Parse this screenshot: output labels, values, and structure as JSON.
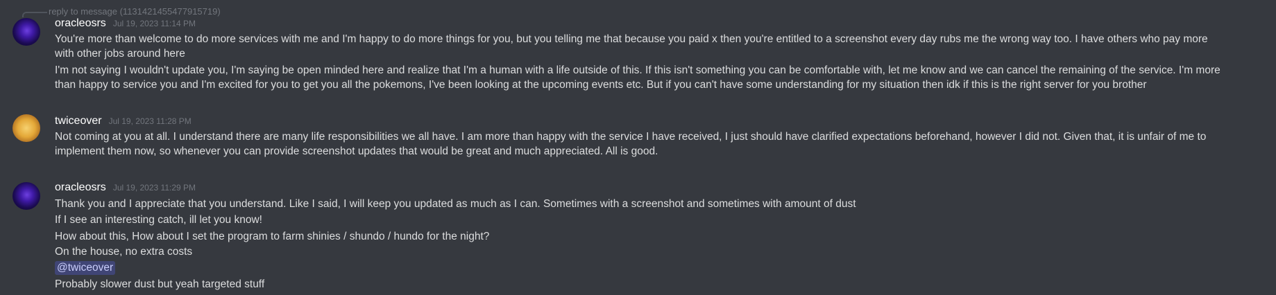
{
  "reply": {
    "text": "reply to message (1131421455477915719)"
  },
  "messages": [
    {
      "username": "oracleosrs",
      "timestamp": "Jul 19, 2023 11:14 PM",
      "lines": [
        "You're more than welcome to do more services with me and I'm happy to do more things for you, but you telling me that because you paid x then you're entitled to a screenshot every day rubs me the wrong way too. I have others who pay more",
        "with other jobs around here",
        "I'm not saying I wouldn't update you, I'm saying be open minded here and realize that I'm a human with a life outside of this. If this isn't something you can be comfortable with, let me know and we can cancel the remaining of the service. I'm more",
        "than happy to service you and I'm excited for you to get you all the pokemons, I've been looking at the upcoming events etc. But if you can't have some understanding for my situation then idk if this is the right server for you brother"
      ]
    },
    {
      "username": "twiceover",
      "timestamp": "Jul 19, 2023 11:28 PM",
      "lines": [
        "Not coming at you at all. I understand there are many life responsibilities we all have. I am more than happy with the service I have received, I just should have clarified expectations beforehand, however I did not. Given that, it is unfair of me to",
        "implement them now, so whenever you can provide screenshot updates that would be great and much appreciated. All is good."
      ]
    },
    {
      "username": "oracleosrs",
      "timestamp": "Jul 19, 2023 11:29 PM",
      "lines": [
        "Thank you and I appreciate that you understand. Like I said, I will keep you updated as much as I can. Sometimes with a screenshot and sometimes with amount of dust",
        "If I see an interesting catch, ill let you know!",
        "How about this, How about I set the program to farm shinies / shundo / hundo for the night?",
        "On the house, no extra costs",
        "@twiceover",
        "Probably slower dust but yeah targeted stuff"
      ]
    }
  ],
  "colors": {
    "background": "#36393f",
    "text": "#dcddde",
    "username": "#ffffff",
    "timestamp": "#72767d",
    "mention_bg": "#4e568f",
    "mention_text": "#c9cdfb"
  }
}
